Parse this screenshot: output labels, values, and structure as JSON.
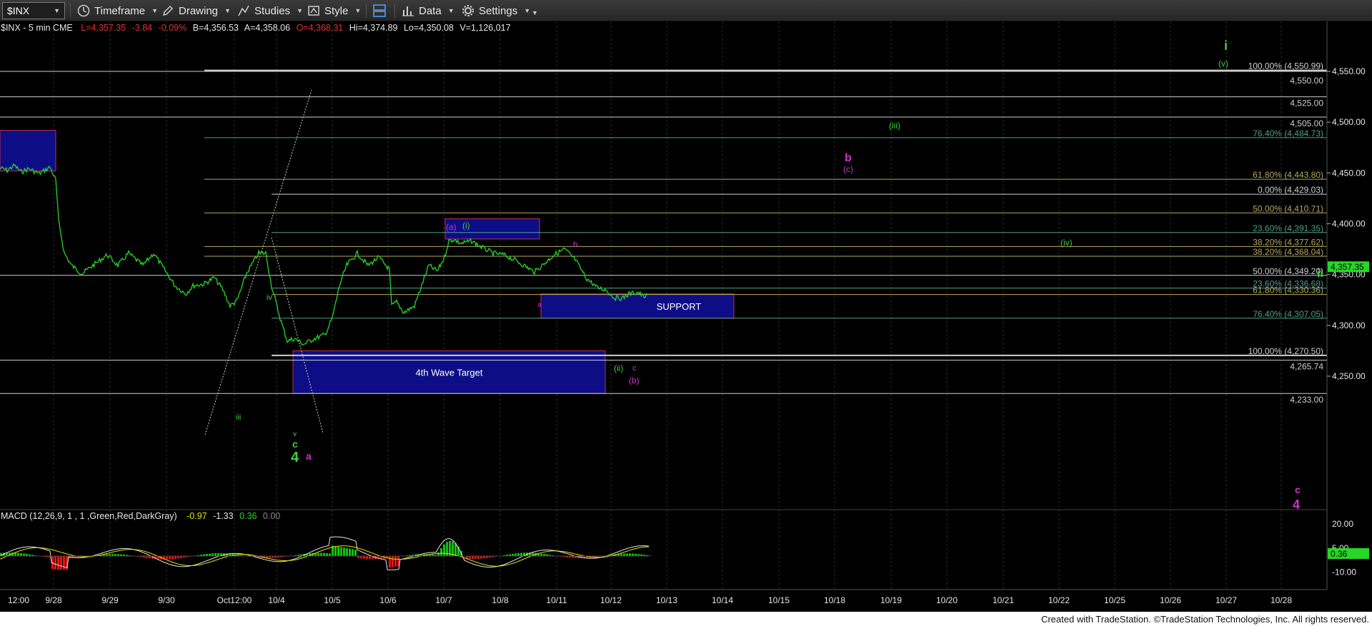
{
  "toolbar": {
    "symbol": "$INX",
    "timeframe": "Timeframe",
    "drawing": "Drawing",
    "studies": "Studies",
    "style": "Style",
    "data": "Data",
    "settings": "Settings"
  },
  "header": {
    "symbol_info": "$INX - 5 min  CME",
    "last": "L=4,357.35",
    "change": "-3.84",
    "pct": "-0.09%",
    "bid": "B=4,356.53",
    "ask": "A=4,358.06",
    "open": "O=4,368.31",
    "high": "Hi=4,374.89",
    "low": "Lo=4,350.08",
    "volume": "V=1,126,017"
  },
  "colors": {
    "price": "#27d627",
    "grid": "#2c2c2c",
    "white_line": "#cfcfcf",
    "fib_teal": "#4f9e8e",
    "fib_gold": "#b8a862",
    "box_fill": "#0d0d86",
    "box_border": "#c0304a",
    "magenta": "#d030d0",
    "green_label": "#3fcf3f",
    "macd_pos": "#12c012",
    "macd_neg": "#e01515",
    "up": "#e03030"
  },
  "price_axis": [
    "4,550.00",
    "4,500.00",
    "4,450.00",
    "4,400.00",
    "4,350.00",
    "4,300.00",
    "4,250.00"
  ],
  "last_price_tag": "4,357.35",
  "time_axis": [
    "12:00",
    "9/28",
    "9/29",
    "9/30",
    "Oct12:00",
    "10/4",
    "10/5",
    "10/6",
    "10/7",
    "10/8",
    "10/11",
    "10/12",
    "10/13",
    "10/14",
    "10/15",
    "10/18",
    "10/19",
    "10/20",
    "10/21",
    "10/22",
    "10/25",
    "10/26",
    "10/27",
    "10/28"
  ],
  "levels": [
    {
      "label": "100.00% (4,550.99)",
      "price": 4550.99,
      "kind": "white"
    },
    {
      "label": "4,550.00",
      "price": 4550,
      "kind": "white"
    },
    {
      "label": "4,525.00",
      "price": 4525,
      "kind": "white"
    },
    {
      "label": "4,505.00",
      "price": 4505,
      "kind": "white"
    },
    {
      "label": "76.40% (4,484.73)",
      "price": 4484.73,
      "kind": "teal"
    },
    {
      "label": "61.80% (4,443.80)",
      "price": 4443.8,
      "kind": "gold"
    },
    {
      "label": "0.00% (4,429.03)",
      "price": 4429.03,
      "kind": "white"
    },
    {
      "label": "50.00% (4,410.71)",
      "price": 4410.71,
      "kind": "gold"
    },
    {
      "label": "23.60% (4,391.35)",
      "price": 4391.35,
      "kind": "teal"
    },
    {
      "label": "38.20% (4,377.62)",
      "price": 4377.62,
      "kind": "gold"
    },
    {
      "label": "38.20% (4,368.04)",
      "price": 4368.04,
      "kind": "gold"
    },
    {
      "label": "50.00% (4,349.20)",
      "price": 4349.2,
      "kind": "white"
    },
    {
      "label": "23.60% (4,336.68)",
      "price": 4336.68,
      "kind": "teal"
    },
    {
      "label": "61.80% (4,330.36)",
      "price": 4330.36,
      "kind": "gold"
    },
    {
      "label": "76.40% (4,307.05)",
      "price": 4307.05,
      "kind": "teal"
    },
    {
      "label": "100.00% (4,270.50)",
      "price": 4270.5,
      "kind": "white"
    },
    {
      "label": "4,265.74",
      "price": 4265.74,
      "kind": "white"
    },
    {
      "label": "4,233.00",
      "price": 4233,
      "kind": "white"
    }
  ],
  "boxes": [
    {
      "price_top": 4492,
      "price_bottom": 4452
    },
    {
      "price_top": 4405,
      "price_bottom": 4385
    },
    {
      "price_top": 4331,
      "price_bottom": 4307,
      "label": "SUPPORT"
    },
    {
      "price_top": 4275,
      "price_bottom": 4233,
      "label": "4th Wave Target"
    }
  ],
  "wave_labels": {
    "i": "i",
    "v": "(v)",
    "iii": "(iii)",
    "b": "b",
    "c_paren": "(c)",
    "a_paren": "(a)",
    "i_paren": "(i)",
    "iv": "(iv)",
    "b_small": "b",
    "a_small": "a",
    "ii": "ii",
    "iv_roman": "iv",
    "iii_roman": "iii",
    "v_roman": "v",
    "c_green": "c",
    "four_green": "4",
    "a_magenta": "a",
    "ii_paren": "(ii)",
    "c_magenta": "c",
    "b_paren": "(b)",
    "c_bottom": "c",
    "four_bottom": "4"
  },
  "macd": {
    "label": "MACD (12,26,9, 1 , 1 ,Green,Red,DarkGray)",
    "v1": "-0.97",
    "v2": "-1.33",
    "v3": "0.36",
    "v4": "0.00",
    "axis": [
      "20.00",
      "5.00",
      "-10.00"
    ],
    "tag": "0.36"
  },
  "footer": "Created with TradeStation. ©TradeStation Technologies, Inc. All rights reserved."
}
